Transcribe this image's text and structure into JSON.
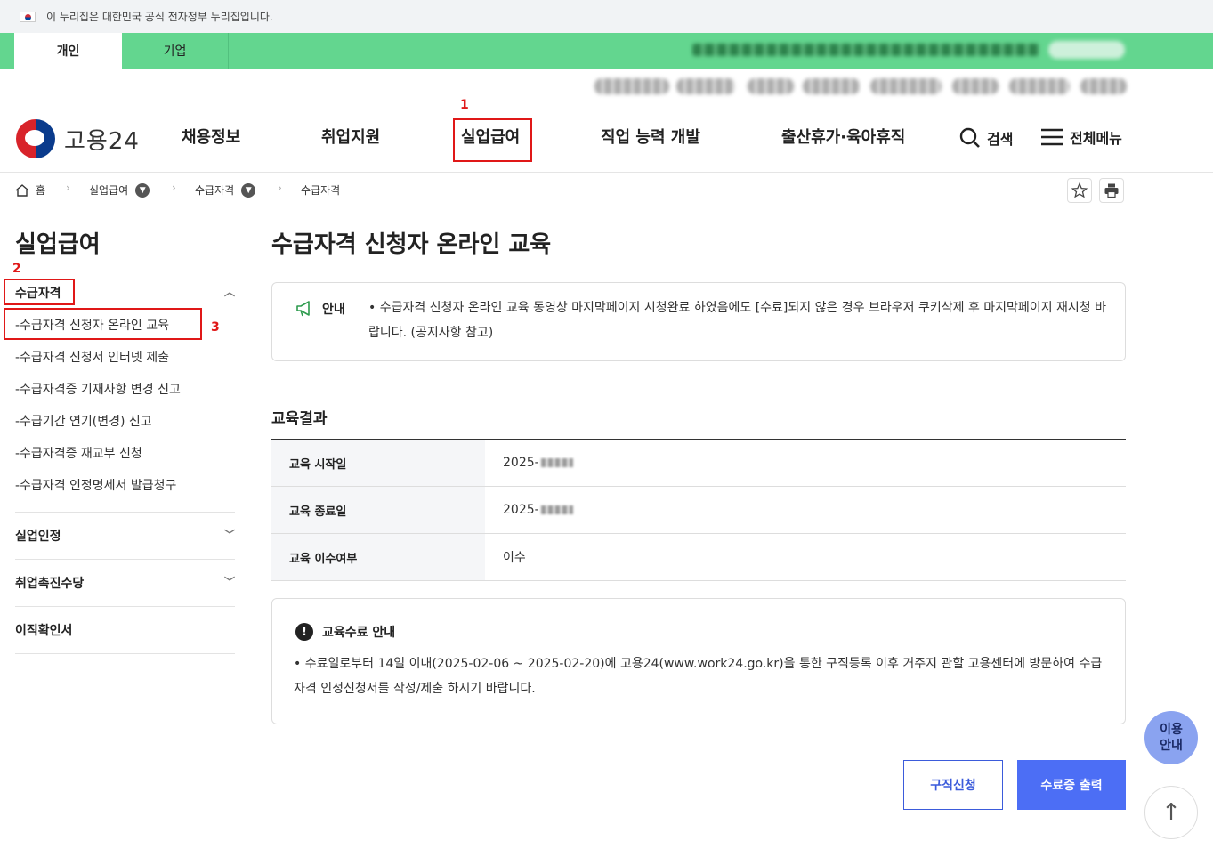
{
  "gov_bar": {
    "text": "이 누리집은 대한민국 공식 전자정부 누리집입니다."
  },
  "tabs": {
    "personal": "개인",
    "business": "기업"
  },
  "logo": {
    "text": "고용24"
  },
  "nav": [
    {
      "label": "채용정보"
    },
    {
      "label": "취업지원"
    },
    {
      "label": "실업급여"
    },
    {
      "label": "직업 능력 개발"
    },
    {
      "label": "출산휴가·육아휴직"
    }
  ],
  "header_tools": {
    "search": "검색",
    "menu": "전체메뉴"
  },
  "annotations": {
    "n1": "1",
    "n2": "2",
    "n3": "3"
  },
  "breadcrumb": {
    "home": "홈",
    "level1": "실업급여",
    "level2": "수급자격",
    "level3": "수급자격"
  },
  "sidebar": {
    "title": "실업급여",
    "group_open": "수급자격",
    "sub_items": [
      "-수급자격 신청자 온라인 교육",
      "-수급자격 신청서 인터넷 제출",
      "-수급자격증 기재사항 변경 신고",
      "-수급기간 연기(변경) 신고",
      "-수급자격증 재교부 신청",
      "-수급자격 인정명세서 발급청구"
    ],
    "groups": [
      "실업인정",
      "취업촉진수당",
      "이직확인서"
    ]
  },
  "main": {
    "title": "수급자격 신청자 온라인 교육",
    "notice_label": "안내",
    "notice_text": "• 수급자격 신청자 온라인 교육 동영상 마지막페이지 시청완료 하였음에도 [수료]되지 않은 경우 브라우저 쿠키삭제 후 마지막페이지 재시청 바랍니다. (공지사항 참고)",
    "section_title": "교육결과",
    "rows": [
      {
        "label": "교육 시작일",
        "value": "2025-"
      },
      {
        "label": "교육 종료일",
        "value": "2025-"
      },
      {
        "label": "교육 이수여부",
        "value": "이수"
      }
    ],
    "complete_title": "교육수료 안내",
    "complete_text": "• 수료일로부터 14일 이내(2025-02-06 ~ 2025-02-20)에 고용24(www.work24.go.kr)을 통한 구직등록 이후 거주지 관할 고용센터에 방문하여 수급자격 인정신청서를 작성/제출 하시기 바랍니다."
  },
  "buttons": {
    "job_apply": "구직신청",
    "print_cert": "수료증 출력"
  },
  "floating": {
    "guide_line1": "이용",
    "guide_line2": "안내",
    "top": "↑"
  },
  "colors": {
    "green_bar": "#63d68f",
    "primary": "#4c6ef5",
    "annotation": "#e01818"
  }
}
